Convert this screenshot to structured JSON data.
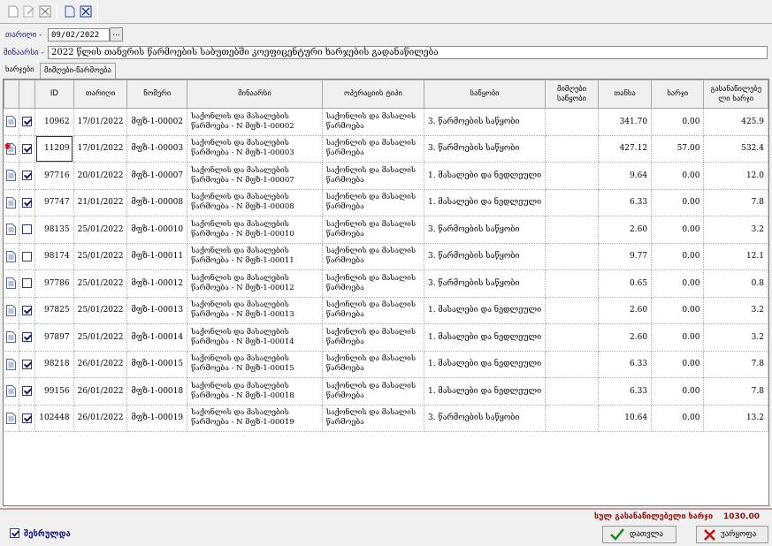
{
  "header": {
    "date_label": "თარიღი -",
    "date_value": "09/02/2022",
    "date_button": "...",
    "desc_label": "შინაარსი -",
    "desc_value": "2022 წლის თანვრის წარმოების საბუთებში კოეფიცენტური ხარჯების გადანაწილება"
  },
  "tabs": [
    {
      "label": "ხარჯები"
    },
    {
      "label": "მიმღები-წარმოება"
    }
  ],
  "columns": [
    "",
    "",
    "ID",
    "თარიღი",
    "ნომერი",
    "შინაარსი",
    "ოპერაციის ტიპი",
    "საწყობი",
    "მიმღები საწყობი",
    "თანხა",
    "ხარჯი",
    "გასანაწილებე ლი ხარჯი"
  ],
  "rows": [
    {
      "id": "10962",
      "date": "17/01/2022",
      "number": "მფზ-1-00002",
      "content": "საქონლის და მასალების წარმოება - N მფზ-1-00002",
      "op_type": "საქონლის და მასალის წარმოება",
      "warehouse": "3. წარმოების საწყობი",
      "recv": "",
      "amount": "341.70",
      "cost": "0.00",
      "dist": "425.9",
      "checked": true,
      "star": false
    },
    {
      "id": "11209",
      "date": "17/01/2022",
      "number": "მფზ-1-00003",
      "content": "საქონლის და მასალების წარმოება - N მფზ-1-00003",
      "op_type": "საქონლის და მასალის წარმოება",
      "warehouse": "3. წარმოების საწყობი",
      "recv": "",
      "amount": "427.12",
      "cost": "57.00",
      "dist": "532.4",
      "checked": true,
      "star": true
    },
    {
      "id": "97716",
      "date": "20/01/2022",
      "number": "მფზ-1-00007",
      "content": "საქონლის და მასალების წარმოება - N მფზ-1-00007",
      "op_type": "საქონლის და მასალის წარმოება",
      "warehouse": "1. მასალები და ნედლეული",
      "recv": "",
      "amount": "9.64",
      "cost": "0.00",
      "dist": "12.0",
      "checked": true,
      "star": false
    },
    {
      "id": "97747",
      "date": "21/01/2022",
      "number": "მფზ-1-00008",
      "content": "საქონლის და მასალების წარმოება - N მფზ-1-00008",
      "op_type": "საქონლის და მასალის წარმოება",
      "warehouse": "1. მასალები და ნედლეული",
      "recv": "",
      "amount": "6.33",
      "cost": "0.00",
      "dist": "7.8",
      "checked": true,
      "star": false
    },
    {
      "id": "98135",
      "date": "25/01/2022",
      "number": "მფზ-1-00010",
      "content": "საქონლის და მასალების წარმოება - N მფზ-1-00010",
      "op_type": "საქონლის და მასალის წარმოება",
      "warehouse": "3. წარმოების საწყობი",
      "recv": "",
      "amount": "2.60",
      "cost": "0.00",
      "dist": "3.2",
      "checked": false,
      "star": false
    },
    {
      "id": "98174",
      "date": "25/01/2022",
      "number": "მფზ-1-00011",
      "content": "საქონლის და მასალების წარმოება - N მფზ-1-00011",
      "op_type": "საქონლის და მასალის წარმოება",
      "warehouse": "3. წარმოების საწყობი",
      "recv": "",
      "amount": "9.77",
      "cost": "0.00",
      "dist": "12.1",
      "checked": false,
      "star": false
    },
    {
      "id": "97786",
      "date": "25/01/2022",
      "number": "მფზ-1-00012",
      "content": "საქონლის და მასალების წარმოება - N მფზ-1-00012",
      "op_type": "საქონლის და მასალის წარმოება",
      "warehouse": "3. წარმოების საწყობი",
      "recv": "",
      "amount": "0.65",
      "cost": "0.00",
      "dist": "0.8",
      "checked": false,
      "star": false
    },
    {
      "id": "97825",
      "date": "25/01/2022",
      "number": "მფზ-1-00013",
      "content": "საქონლის და მასალების წარმოება - N მფზ-1-00013",
      "op_type": "საქონლის და მასალის წარმოება",
      "warehouse": "1. მასალები და ნედლეული",
      "recv": "",
      "amount": "2.60",
      "cost": "0.00",
      "dist": "3.2",
      "checked": true,
      "star": false
    },
    {
      "id": "97897",
      "date": "25/01/2022",
      "number": "მფზ-1-00014",
      "content": "საქონლის და მასალების წარმოება - N მფზ-1-00014",
      "op_type": "საქონლის და მასალის წარმოება",
      "warehouse": "1. მასალები და ნედლეული",
      "recv": "",
      "amount": "2.60",
      "cost": "0.00",
      "dist": "3.2",
      "checked": true,
      "star": false
    },
    {
      "id": "98218",
      "date": "26/01/2022",
      "number": "მფზ-1-00015",
      "content": "საქონლის და მასალების წარმოება - N მფზ-1-00015",
      "op_type": "საქონლის და მასალის წარმოება",
      "warehouse": "1. მასალები და ნედლეული",
      "recv": "",
      "amount": "6.33",
      "cost": "0.00",
      "dist": "7.8",
      "checked": true,
      "star": false
    },
    {
      "id": "99156",
      "date": "26/01/2022",
      "number": "მფზ-1-00018",
      "content": "საქონლის და მასალების წარმოება - N მფზ-1-00018",
      "op_type": "საქონლის და მასალის წარმოება",
      "warehouse": "1. მასალები და ნედლეული",
      "recv": "",
      "amount": "6.33",
      "cost": "0.00",
      "dist": "7.8",
      "checked": true,
      "star": false
    },
    {
      "id": "102448",
      "date": "26/01/2022",
      "number": "მფზ-1-00019",
      "content": "საქონლის და მასალების წარმოება - N მფზ-1-00019",
      "op_type": "საქონლის და მასალის წარმოება",
      "warehouse": "3. წარმოების საწყობი",
      "recv": "",
      "amount": "10.64",
      "cost": "0.00",
      "dist": "13.2",
      "checked": true,
      "star": false
    }
  ],
  "footer": {
    "total_label": "სულ გასანაწილებელი ხარჯი",
    "total_value": "1030.00",
    "done_label": "შესრულდა",
    "done_checked": true,
    "calc_button": "დათვლა",
    "cancel_button": "უარყოფა"
  },
  "icons": {
    "toolbar": [
      "new-document-icon",
      "edit-document-icon",
      "delete-icon",
      "copy-icon",
      "clear-icon"
    ],
    "calc": "checkmark-icon",
    "cancel": "cross-icon"
  },
  "colors": {
    "label": "#1a1a9a",
    "total": "#8a1010",
    "check": "#2a3a8a",
    "confirm_icon": "#1a8a1a",
    "cancel_icon": "#c01010"
  }
}
